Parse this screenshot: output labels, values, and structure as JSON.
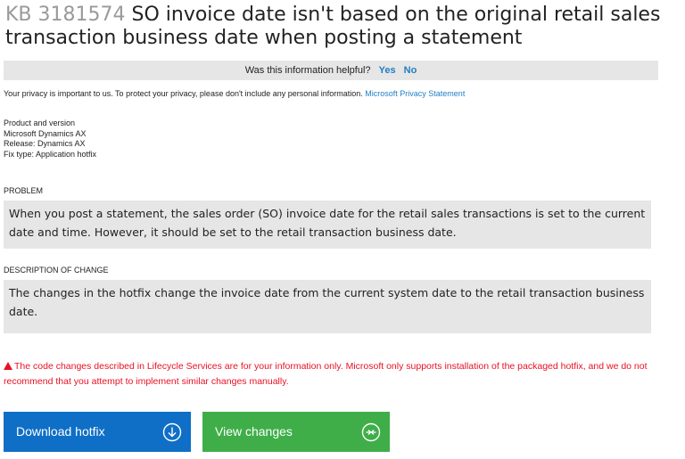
{
  "article": {
    "kb_number": "KB 3181574",
    "title": "SO invoice date isn't based on the original retail sales transaction business date when posting a statement"
  },
  "feedback": {
    "question": "Was this information helpful?",
    "yes_label": "Yes",
    "no_label": "No"
  },
  "privacy": {
    "text": "Your privacy is important to us. To protect your privacy, please don't include any personal information.",
    "link_label": "Microsoft Privacy Statement"
  },
  "product": {
    "heading": "Product and version",
    "lines": [
      "Microsoft Dynamics AX",
      "Release: Dynamics AX",
      "Fix type: Application hotfix"
    ]
  },
  "problem": {
    "label": "PROBLEM",
    "text": "When you post a statement, the sales order (SO) invoice date for the retail sales transactions is set to the current date and time. However, it should be set to the retail transaction business date."
  },
  "description": {
    "label": "DESCRIPTION OF CHANGE",
    "text": "The changes in the hotfix change the invoice date from the current system date to the retail transaction business date."
  },
  "warning": {
    "text": "The code changes described in Lifecycle Services are for your information only. Microsoft only supports installation of the packaged hotfix, and we do not recommend that you attempt to implement similar changes manually."
  },
  "buttons": {
    "download_label": "Download hotfix",
    "download_icon": "download-circle-icon",
    "view_label": "View changes",
    "view_icon": "compare-circle-icon"
  },
  "colors": {
    "link_blue": "#1f7fc4",
    "download_blue": "#0f6fc6",
    "view_green": "#3fae49",
    "warning_red": "#e81123",
    "panel_gray": "#e6e6e6"
  }
}
